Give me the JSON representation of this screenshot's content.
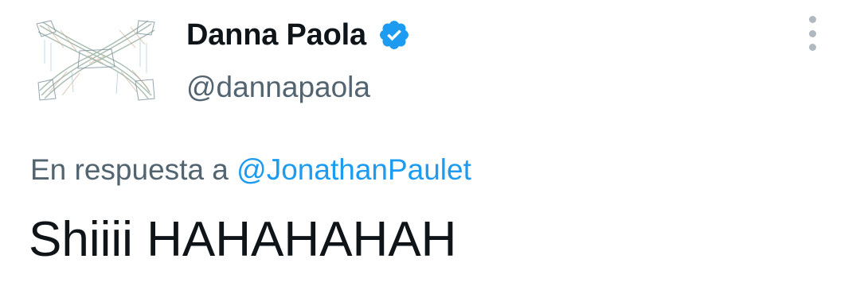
{
  "tweet": {
    "author": {
      "display_name": "Danna Paola",
      "handle": "@dannapaola",
      "verified": true,
      "avatar_icon": "sketch-x-avatar"
    },
    "reply": {
      "prefix": "En respuesta a",
      "user": "@JonathanPaulet"
    },
    "text": "Shiiii HAHAHAHAH"
  },
  "colors": {
    "name": "#0f1419",
    "secondary_text": "#536471",
    "link": "#1d9bf0",
    "verified_badge": "#1d9bf0",
    "more_dots": "#b0b9c2"
  },
  "icons": {
    "verified": "verified-badge-icon",
    "more": "more-options-icon"
  }
}
